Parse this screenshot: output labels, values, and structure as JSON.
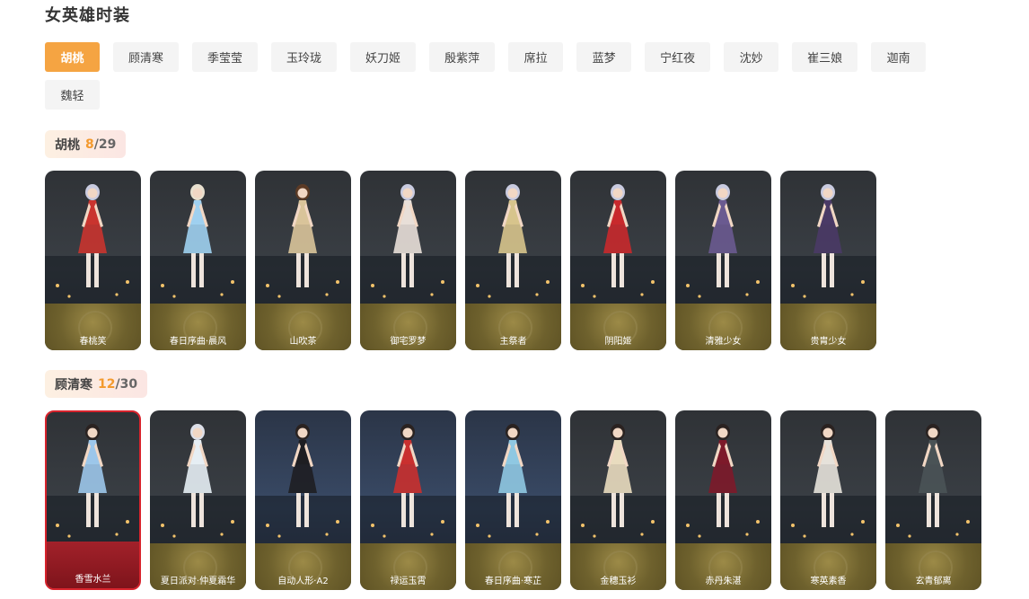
{
  "page": {
    "title": "女英雄时装"
  },
  "heroes": [
    "胡桃",
    "顾清寒",
    "季莹莹",
    "玉玲珑",
    "妖刀姬",
    "殷紫萍",
    "席拉",
    "蓝梦",
    "宁红夜",
    "沈妙",
    "崔三娘",
    "迦南",
    "魏轻"
  ],
  "active_hero": "胡桃",
  "sections": [
    {
      "name": "胡桃",
      "owned": "8",
      "total": "/29",
      "skins": [
        {
          "name": "春桃笑",
          "color": "#c9342f",
          "hair": "#c9cbe0"
        },
        {
          "name": "春日序曲·晨风",
          "color": "#9fd0f0",
          "hair": "#e8e0cf"
        },
        {
          "name": "山吹茶",
          "color": "#d9c49a",
          "hair": "#5b3a25"
        },
        {
          "name": "御宅罗梦",
          "color": "#e8dfd8",
          "hair": "#c9cbe0"
        },
        {
          "name": "主祭者",
          "color": "#d7c48c",
          "hair": "#c9cbe0"
        },
        {
          "name": "阴阳姬",
          "color": "#c8292c",
          "hair": "#c9cbe0"
        },
        {
          "name": "清雅少女",
          "color": "#6a5a90",
          "hair": "#c9cbe0"
        },
        {
          "name": "贵胄少女",
          "color": "#4a3a66",
          "hair": "#c9cbe0"
        }
      ]
    },
    {
      "name": "顾清寒",
      "owned": "12",
      "total": "/30",
      "skins": [
        {
          "name": "香雪水兰",
          "color": "#9cc6ea",
          "hair": "#2a2220"
        },
        {
          "name": "夏日派对·仲夏霜华",
          "color": "#e6eef4",
          "hair": "#dcdfe8"
        },
        {
          "name": "自动人形·A2",
          "color": "#1e1e22",
          "hair": "#2a2220"
        },
        {
          "name": "禄运玉霄",
          "color": "#c9302f",
          "hair": "#2a2220"
        },
        {
          "name": "春日序曲·寒芷",
          "color": "#8fc8e2",
          "hair": "#2a2220"
        },
        {
          "name": "金穗玉衫",
          "color": "#e9dcbf",
          "hair": "#2a2220"
        },
        {
          "name": "赤丹朱湛",
          "color": "#7d1a2a",
          "hair": "#2a2220"
        },
        {
          "name": "寒英素香",
          "color": "#e6e2da",
          "hair": "#2a2220"
        },
        {
          "name": "玄青郁离",
          "color": "#4a5356",
          "hair": "#2a2220"
        }
      ]
    }
  ]
}
